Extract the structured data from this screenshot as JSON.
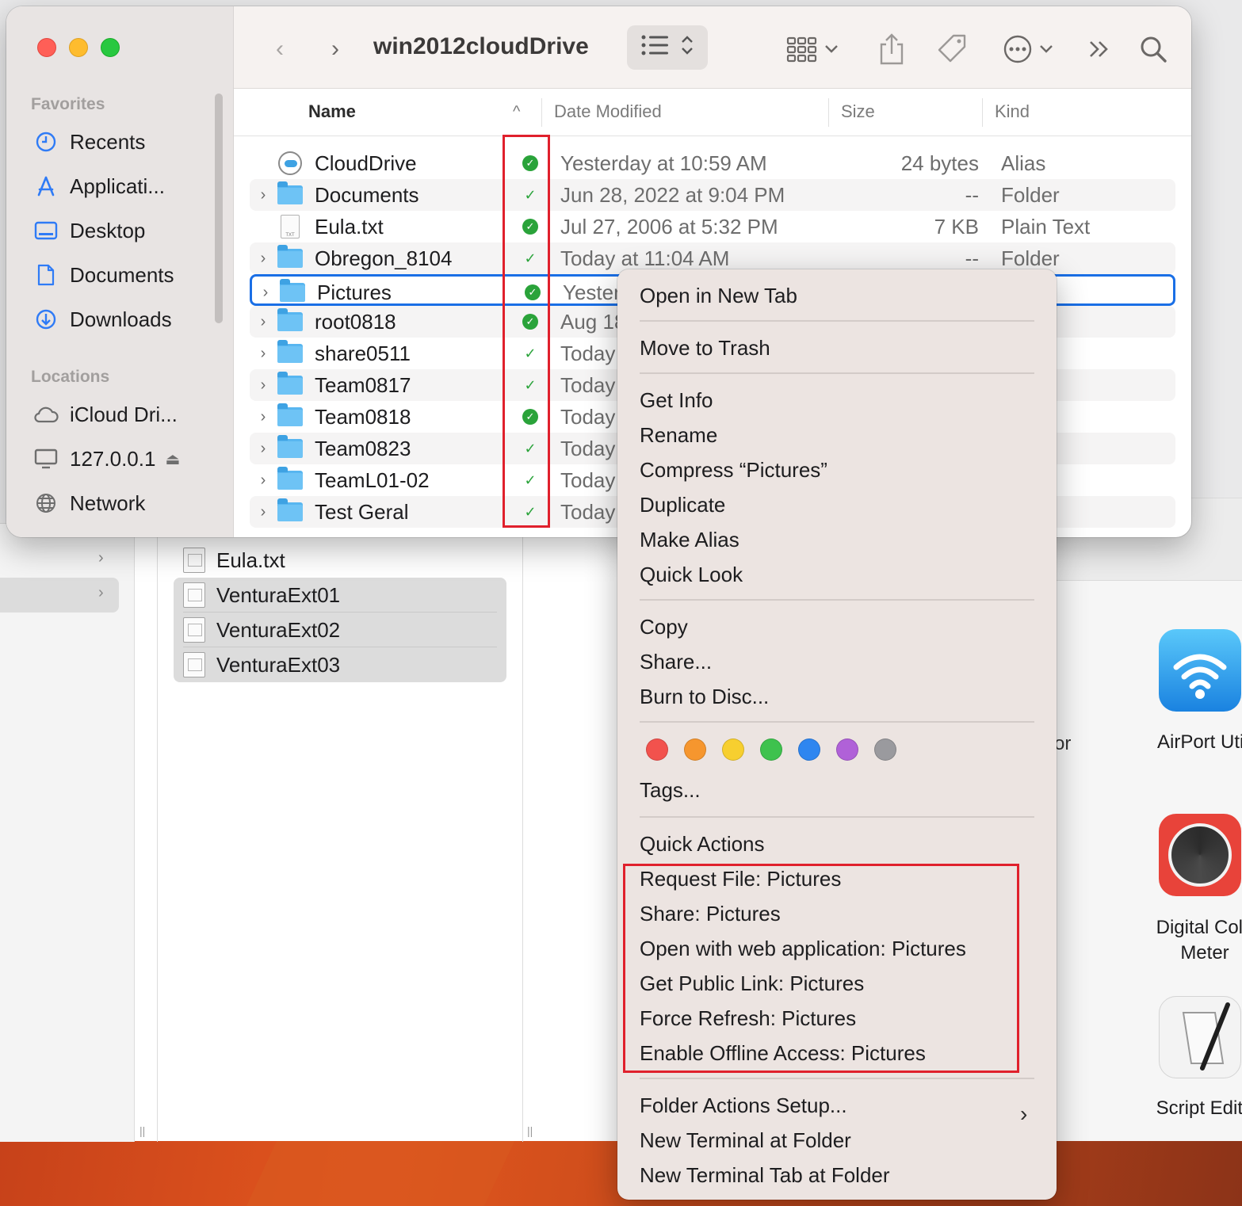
{
  "window": {
    "title": "win2012cloudDrive"
  },
  "sidebar": {
    "favorites_label": "Favorites",
    "favorites": [
      {
        "label": "Recents",
        "icon": "clock-icon"
      },
      {
        "label": "Applicati...",
        "icon": "applications-icon"
      },
      {
        "label": "Desktop",
        "icon": "desktop-icon"
      },
      {
        "label": "Documents",
        "icon": "document-icon"
      },
      {
        "label": "Downloads",
        "icon": "download-icon"
      }
    ],
    "locations_label": "Locations",
    "locations": [
      {
        "label": "iCloud Dri...",
        "icon": "cloud-icon"
      },
      {
        "label": "127.0.0.1",
        "icon": "display-icon"
      },
      {
        "label": "Network",
        "icon": "globe-icon"
      }
    ]
  },
  "columns": {
    "name": "Name",
    "date": "Date Modified",
    "size": "Size",
    "kind": "Kind"
  },
  "files": [
    {
      "name": "CloudDrive",
      "type": "alias",
      "status": "synced-filled",
      "date": "Yesterday at 10:59 AM",
      "size": "24 bytes",
      "kind": "Alias"
    },
    {
      "name": "Documents",
      "type": "folder",
      "status": "synced-check",
      "date": "Jun 28, 2022 at 9:04 PM",
      "size": "--",
      "kind": "Folder"
    },
    {
      "name": "Eula.txt",
      "type": "text",
      "status": "synced-filled",
      "date": "Jul 27, 2006 at 5:32 PM",
      "size": "7 KB",
      "kind": "Plain Text"
    },
    {
      "name": "Obregon_8104",
      "type": "folder",
      "status": "synced-check",
      "date": "Today at 11:04 AM",
      "size": "--",
      "kind": "Folder"
    },
    {
      "name": "Pictures",
      "type": "folder",
      "status": "synced-filled",
      "date": "Yesterd",
      "size": "",
      "kind": ""
    },
    {
      "name": "root0818",
      "type": "folder",
      "status": "synced-filled",
      "date": "Aug 18",
      "size": "",
      "kind": ""
    },
    {
      "name": "share0511",
      "type": "folder",
      "status": "synced-check",
      "date": "Today",
      "size": "",
      "kind": ""
    },
    {
      "name": "Team0817",
      "type": "folder",
      "status": "synced-check",
      "date": "Today",
      "size": "",
      "kind": ""
    },
    {
      "name": "Team0818",
      "type": "folder",
      "status": "synced-filled",
      "date": "Today",
      "size": "",
      "kind": ""
    },
    {
      "name": "Team0823",
      "type": "folder",
      "status": "synced-check",
      "date": "Today",
      "size": "",
      "kind": ""
    },
    {
      "name": "TeamL01-02",
      "type": "folder",
      "status": "synced-check",
      "date": "Today",
      "size": "",
      "kind": ""
    },
    {
      "name": "Test Geral",
      "type": "folder",
      "status": "synced-check",
      "date": "Today",
      "size": "",
      "kind": ""
    }
  ],
  "context_menu": {
    "groups": [
      [
        "Open in New Tab"
      ],
      [
        "Move to Trash"
      ],
      [
        "Get Info",
        "Rename",
        "Compress “Pictures”",
        "Duplicate",
        "Make Alias",
        "Quick Look"
      ],
      [
        "Copy",
        "Share...",
        "Burn to Disc..."
      ]
    ],
    "tag_colors": [
      "#f2524d",
      "#f6962e",
      "#f7cf2f",
      "#3ec24e",
      "#2e86f0",
      "#b061d8",
      "#9a9a9e"
    ],
    "tags_label": "Tags...",
    "quick_actions_label": "Quick Actions",
    "cloud_actions": [
      "Request File: Pictures",
      "Share: Pictures",
      "Open with web application: Pictures",
      "Get Public Link: Pictures",
      "Force Refresh: Pictures",
      "Enable Offline Access: Pictures"
    ],
    "folder_actions": [
      "Folder Actions Setup...",
      "New Terminal at Folder",
      "New Terminal Tab at Folder"
    ]
  },
  "background": {
    "files": [
      "Eula.txt",
      "VenturaExt01",
      "VenturaExt02",
      "VenturaExt03"
    ],
    "apps": [
      {
        "label": "AirPort Utili"
      },
      {
        "label": "Digital Colo Meter"
      },
      {
        "label": "Script Edito"
      }
    ],
    "partial_text": "or"
  }
}
